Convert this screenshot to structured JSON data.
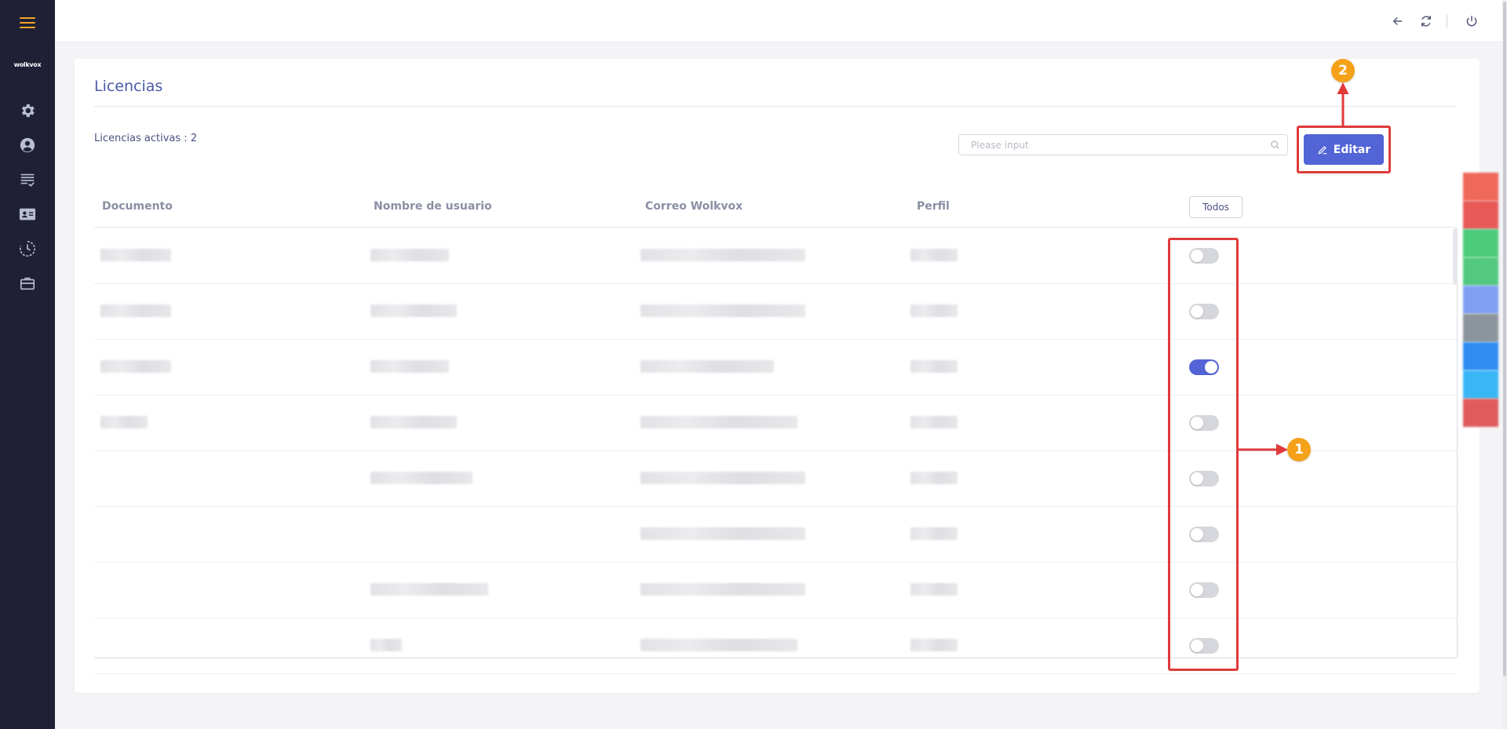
{
  "sidebar": {
    "logo_text": "wolkvox",
    "items": [
      {
        "icon": "gear-icon"
      },
      {
        "icon": "user-circle-icon"
      },
      {
        "icon": "list-check-icon"
      },
      {
        "icon": "id-card-icon"
      },
      {
        "icon": "clock-icon"
      },
      {
        "icon": "briefcase-icon"
      }
    ]
  },
  "topbar": {
    "icons": [
      "back-arrow-icon",
      "refresh-icon",
      "power-icon"
    ]
  },
  "page": {
    "title": "Licencias",
    "active_licenses": "Licencias activas : 2",
    "search_placeholder": "Please input",
    "edit_label": "Editar"
  },
  "table": {
    "headers": [
      "Documento",
      "Nombre de usuario",
      "Correo Wolkvox",
      "Perfil"
    ],
    "toggle_all_label": "Todos",
    "rows": [
      {
        "active": false
      },
      {
        "active": false
      },
      {
        "active": true
      },
      {
        "active": false
      },
      {
        "active": false
      },
      {
        "active": false
      },
      {
        "active": false
      },
      {
        "active": false
      }
    ]
  },
  "annotations": {
    "badge_1": "1",
    "badge_2": "2"
  },
  "colors": {
    "sidebar_bg": "#1f2035",
    "accent": "#5364d6",
    "menu_icon": "#f5a623",
    "annotation_red": "#e03a3a",
    "annotation_badge": "#f5a21a"
  }
}
